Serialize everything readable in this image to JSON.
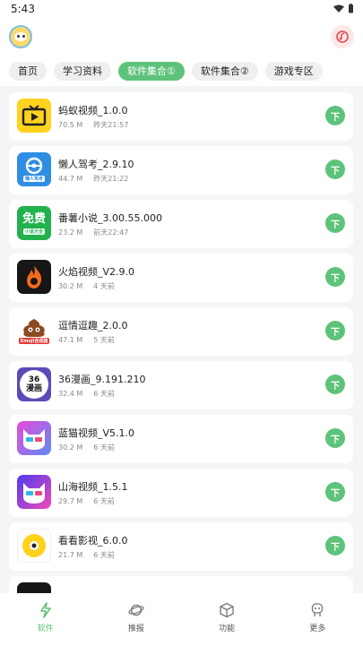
{
  "status": {
    "time": "5:43"
  },
  "tabs": [
    {
      "label": "首页"
    },
    {
      "label": "学习资料"
    },
    {
      "label": "软件集合①",
      "active": true
    },
    {
      "label": "软件集合②"
    },
    {
      "label": "游戏专区"
    }
  ],
  "apps": [
    {
      "name": "蚂蚁视频_1.0.0",
      "size": "70.5 M",
      "time": "昨天21:57",
      "icon": "tv-icon",
      "color": "#ffd21e",
      "button": "下"
    },
    {
      "name": "懒人驾考_2.9.10",
      "size": "44.7 M",
      "time": "昨天21:22",
      "icon": "steering-wheel-icon",
      "color": "#2f8de4",
      "badge": "懒人驾考",
      "button": "下"
    },
    {
      "name": "番薯小说_3.00.55.000",
      "size": "23.2 M",
      "time": "前天22:47",
      "icon": "free-icon",
      "color": "#21b14d",
      "icon_text": "免费",
      "badge": "小说大全",
      "button": "下"
    },
    {
      "name": "火焰视频_V2.9.0",
      "size": "30.2 M",
      "time": "4 天前",
      "icon": "flame-icon",
      "color": "#161616",
      "button": "下"
    },
    {
      "name": "逗情逗趣_2.0.0",
      "size": "47.1 M",
      "time": "5 天前",
      "icon": "emoji-icon",
      "color": "#ffffff",
      "badge": "Emoji合成器",
      "button": "下"
    },
    {
      "name": "36漫画_9.191.210",
      "size": "32.4 M",
      "time": "6 天前",
      "icon": "comic-icon",
      "color": "#5a4bb8",
      "icon_text": "36 漫画",
      "button": "下"
    },
    {
      "name": "蓝猫视频_V5.1.0",
      "size": "30.2 M",
      "time": "6 天前",
      "icon": "cat-icon",
      "color": "#8a6cf0",
      "button": "下"
    },
    {
      "name": "山海视频_1.5.1",
      "size": "29.7 M",
      "time": "6 天前",
      "icon": "cat-icon",
      "color": "#3d5cf0",
      "button": "下"
    },
    {
      "name": "看看影视_6.0.0",
      "size": "21.7 M",
      "time": "6 天前",
      "icon": "eye-icon",
      "color": "#ffd21e",
      "button": "下"
    }
  ],
  "nav": [
    {
      "label": "软件",
      "icon": "lightning-icon",
      "active": true
    },
    {
      "label": "推报",
      "icon": "planet-icon"
    },
    {
      "label": "功能",
      "icon": "cube-icon"
    },
    {
      "label": "更多",
      "icon": "robot-icon"
    }
  ],
  "colors": {
    "accent": "#5ec37a",
    "background": "#f4f5f7"
  }
}
